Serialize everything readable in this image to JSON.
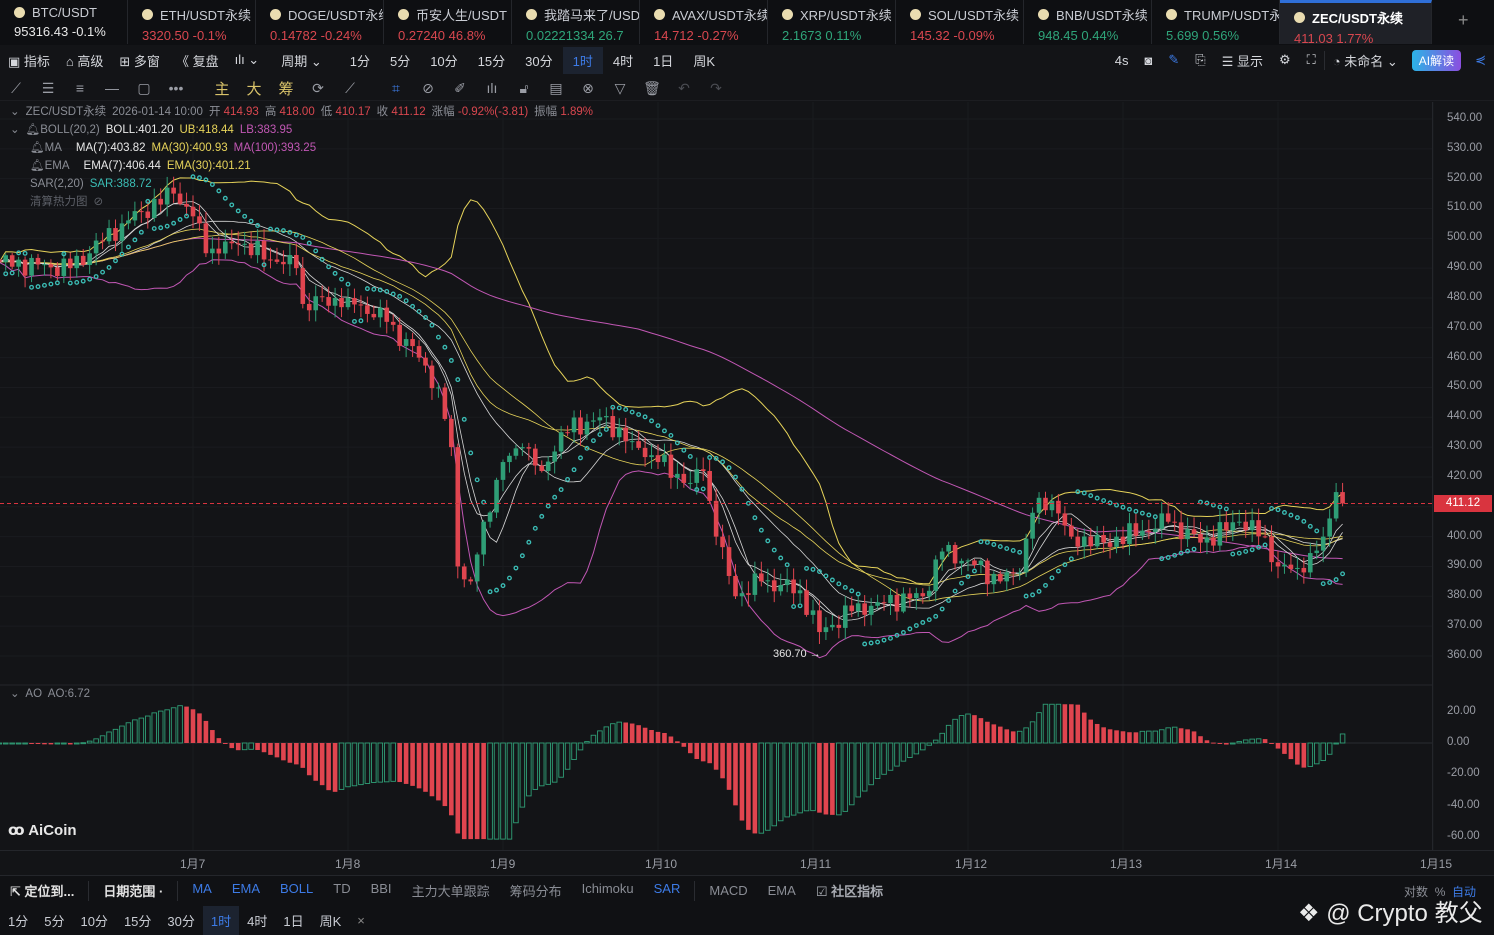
{
  "tabs": [
    {
      "symbol": "BTC/USDT",
      "price": "95316.43",
      "change": "-0.1%",
      "color": "white",
      "active": false
    },
    {
      "symbol": "ETH/USDT永续",
      "price": "3320.50",
      "change": "-0.1%",
      "color": "down"
    },
    {
      "symbol": "DOGE/USDT永续",
      "price": "0.14782",
      "change": "-0.24%",
      "color": "down"
    },
    {
      "symbol": "币安人生/USDT",
      "price": "0.27240",
      "change": "46.8%",
      "color": "down"
    },
    {
      "symbol": "我踏马来了/USDT",
      "price": "0.02221334",
      "change": "26.7",
      "color": "up"
    },
    {
      "symbol": "AVAX/USDT永续",
      "price": "14.712",
      "change": "-0.27%",
      "color": "down"
    },
    {
      "symbol": "XRP/USDT永续",
      "price": "2.1673",
      "change": "0.11%",
      "color": "up"
    },
    {
      "symbol": "SOL/USDT永续",
      "price": "145.32",
      "change": "-0.09%",
      "color": "down"
    },
    {
      "symbol": "BNB/USDT永续",
      "price": "948.45",
      "change": "0.44%",
      "color": "up"
    },
    {
      "symbol": "TRUMP/USDT永续",
      "price": "5.699",
      "change": "0.56%",
      "color": "up"
    },
    {
      "symbol": "ZEC/USDT永续",
      "price": "411.03",
      "change": "1.77%",
      "color": "down",
      "active": true
    }
  ],
  "add_tab": "+",
  "toolbar": {
    "indicators": "指标",
    "advanced": "高级",
    "multi": "多窗",
    "replay": "复盘",
    "period": "周期",
    "timeframes": [
      "1分",
      "5分",
      "10分",
      "15分",
      "30分",
      "1时",
      "4时",
      "1日",
      "周K"
    ],
    "selected_tf": "1时",
    "refresh": "4s",
    "display": "显示",
    "layout": "未命名",
    "ai": "AI解读"
  },
  "draw_tools": {
    "main": "主",
    "big": "大",
    "chip": "筹"
  },
  "legend": {
    "symbol": "ZEC/USDT永续",
    "time": "2026-01-14 10:00",
    "open_l": "开",
    "open": "414.93",
    "high_l": "高",
    "high": "418.00",
    "low_l": "低",
    "low": "410.17",
    "close_l": "收",
    "close": "411.12",
    "chg_l": "涨幅",
    "chg": "-0.92%(-3.81)",
    "amp_l": "振幅",
    "amp": "1.89%",
    "boll_name": "BOLL(20,2)",
    "boll": "BOLL:401.20",
    "ub": "UB:418.44",
    "lb": "LB:383.95",
    "ma_name": "MA",
    "ma7": "MA(7):403.82",
    "ma30": "MA(30):400.93",
    "ma100": "MA(100):393.25",
    "ema_name": "EMA",
    "ema7": "EMA(7):406.44",
    "ema30": "EMA(30):401.21",
    "sar_name": "SAR(2,20)",
    "sar": "SAR:388.72",
    "heatmap": "清算热力图"
  },
  "ao_legend": {
    "name": "AO",
    "value": "AO:6.72"
  },
  "low_marker": "360.70 →",
  "logo": "AiCoin",
  "colors": {
    "up": "#2f9e76",
    "down": "#e0454f",
    "ma7": "#d6d6d6",
    "ma30": "#e6d35a",
    "ma100": "#c157b4",
    "boll_ub": "#e6d35a",
    "boll_lb": "#c157b4",
    "sar": "#3bbdb5",
    "last_price": "#d9343f"
  },
  "chart_data": {
    "type": "candlestick",
    "interval": "1h",
    "price_axis": {
      "ticks": [
        "540.00",
        "530.00",
        "520.00",
        "510.00",
        "500.00",
        "490.00",
        "480.00",
        "470.00",
        "460.00",
        "450.00",
        "440.00",
        "430.00",
        "420.00",
        "410.00",
        "400.00",
        "390.00",
        "380.00",
        "370.00",
        "360.00"
      ],
      "range": [
        360,
        540
      ]
    },
    "ao_axis": {
      "ticks": [
        "20.00",
        "0.00",
        "-20.00",
        "-40.00",
        "-60.00"
      ],
      "range": [
        -60,
        20
      ]
    },
    "time_axis": [
      "1月7",
      "1月8",
      "1月9",
      "1月10",
      "1月11",
      "1月12",
      "1月13",
      "1月14",
      "1月15"
    ],
    "last_price": "411.12",
    "low_annotation": 360.7,
    "close_path": [
      [
        "2026-01-05 18:00",
        492
      ],
      [
        "2026-01-06 05:00",
        490
      ],
      [
        "2026-01-06 13:00",
        505
      ],
      [
        "2026-01-06 21:00",
        515
      ],
      [
        "2026-01-07 01:00",
        505
      ],
      [
        "2026-01-07 02:00",
        495
      ],
      [
        "2026-01-07 07:00",
        498
      ],
      [
        "2026-01-07 16:00",
        490
      ],
      [
        "2026-01-07 17:00",
        478
      ],
      [
        "2026-01-08 00:00",
        480
      ],
      [
        "2026-01-08 06:00",
        472
      ],
      [
        "2026-01-08 11:00",
        460
      ],
      [
        "2026-01-08 14:00",
        450
      ],
      [
        "2026-01-08 16:00",
        430
      ],
      [
        "2026-01-08 17:00",
        390
      ],
      [
        "2026-01-08 19:00",
        385
      ],
      [
        "2026-01-08 21:00",
        405
      ],
      [
        "2026-01-09 00:00",
        425
      ],
      [
        "2026-01-09 03:00",
        430
      ],
      [
        "2026-01-09 06:00",
        422
      ],
      [
        "2026-01-09 09:00",
        435
      ],
      [
        "2026-01-09 15:00",
        440
      ],
      [
        "2026-01-09 20:00",
        432
      ],
      [
        "2026-01-10 00:00",
        425
      ],
      [
        "2026-01-10 05:00",
        418
      ],
      [
        "2026-01-10 07:00",
        422
      ],
      [
        "2026-01-10 09:00",
        400
      ],
      [
        "2026-01-10 12:00",
        380
      ],
      [
        "2026-01-10 16:00",
        385
      ],
      [
        "2026-01-10 22:00",
        382
      ],
      [
        "2026-01-11 01:00",
        368
      ],
      [
        "2026-01-11 06:00",
        375
      ],
      [
        "2026-01-11 10:00",
        378
      ],
      [
        "2026-01-11 17:00",
        380
      ],
      [
        "2026-01-11 20:00",
        395
      ],
      [
        "2026-01-12 00:00",
        392
      ],
      [
        "2026-01-12 05:00",
        385
      ],
      [
        "2026-01-12 08:00",
        388
      ],
      [
        "2026-01-12 10:00",
        408
      ],
      [
        "2026-01-12 13:00",
        412
      ],
      [
        "2026-01-12 16:00",
        400
      ],
      [
        "2026-01-12 21:00",
        398
      ],
      [
        "2026-01-13 03:00",
        402
      ],
      [
        "2026-01-13 07:00",
        405
      ],
      [
        "2026-01-13 12:00",
        398
      ],
      [
        "2026-01-13 18:00",
        405
      ],
      [
        "2026-01-13 22:00",
        400
      ],
      [
        "2026-01-14 00:00",
        390
      ],
      [
        "2026-01-14 04:00",
        388
      ],
      [
        "2026-01-14 07:00",
        400
      ],
      [
        "2026-01-14 09:00",
        414.93
      ],
      [
        "2026-01-14 10:00",
        411.12
      ]
    ]
  },
  "bottom": {
    "locate": "定位到...",
    "range": "日期范围",
    "indicators": [
      "MA",
      "EMA",
      "BOLL",
      "TD",
      "BBI",
      "主力大单跟踪",
      "筹码分布",
      "Ichimoku",
      "SAR"
    ],
    "active_indicators": [
      "MA",
      "EMA",
      "BOLL",
      "SAR"
    ],
    "sub": [
      "MACD",
      "EMA"
    ],
    "community": "社区指标",
    "log": "对数",
    "pct": "%",
    "auto": "自动",
    "close": "×"
  },
  "watermark": "@ Crypto 教父"
}
